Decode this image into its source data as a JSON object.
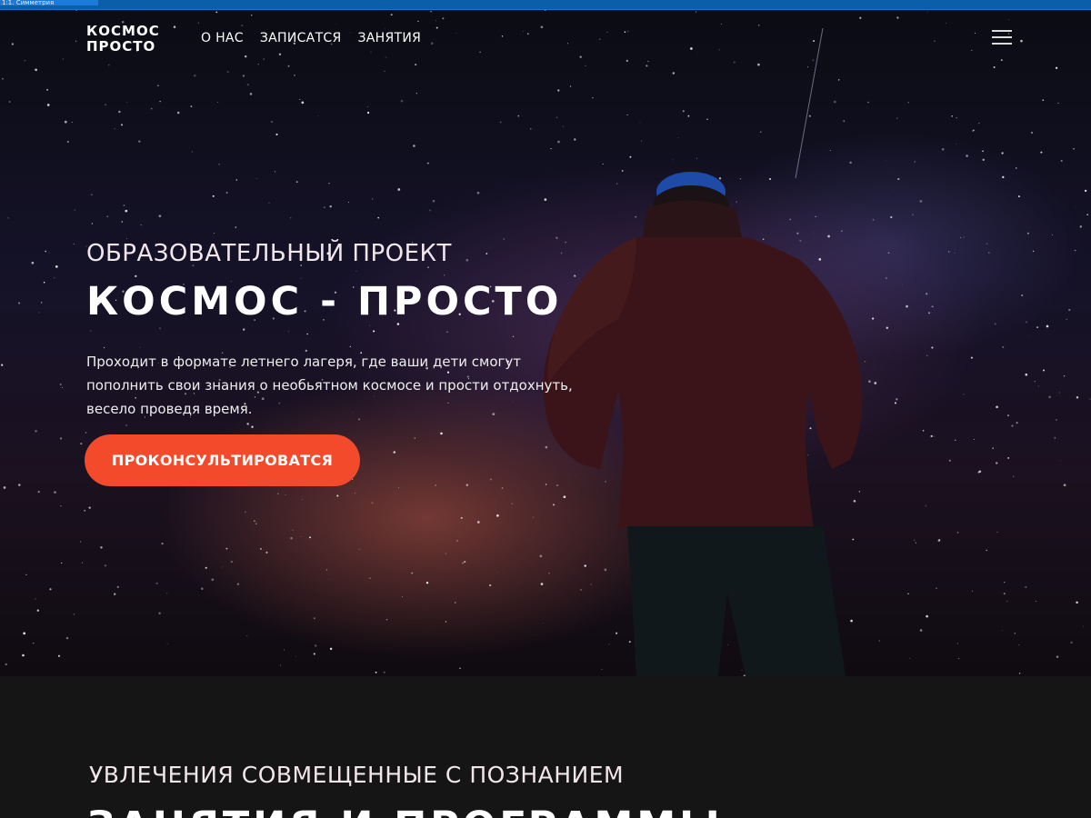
{
  "window": {
    "tab_label": "1:1. Симметрия"
  },
  "header": {
    "logo_line1": "КОСМОС",
    "logo_line2": "ПРОСТО",
    "nav": [
      {
        "label": "О НАС"
      },
      {
        "label": "ЗАПИСАТСЯ"
      },
      {
        "label": "ЗАНЯТИЯ"
      }
    ],
    "menu_icon": "hamburger-menu-icon"
  },
  "hero": {
    "eyebrow": "ОБРАЗОВАТЕЛЬНЫЙ ПРОЕКТ",
    "title": "КОСМОС - ПРОСТО",
    "description": "Проходит в формате летнего лагеря, где ваши дети смогут пополнить свои знания о необьятном космосе и прости отдохнуть, весело проведя время.",
    "cta_label": "ПРОКОНСУЛЬТИРОВАТСЯ"
  },
  "section": {
    "eyebrow": "УВЛЕЧЕНИЯ СОВМЕЩЕННЫЕ С ПОЗНАНИЕМ",
    "title": "ЗАНЯТИЯ И ПРОГРАММЫ"
  },
  "colors": {
    "accent": "#f24a2a",
    "dark_bg": "#151515",
    "browser_bar": "#0b5ea8"
  }
}
